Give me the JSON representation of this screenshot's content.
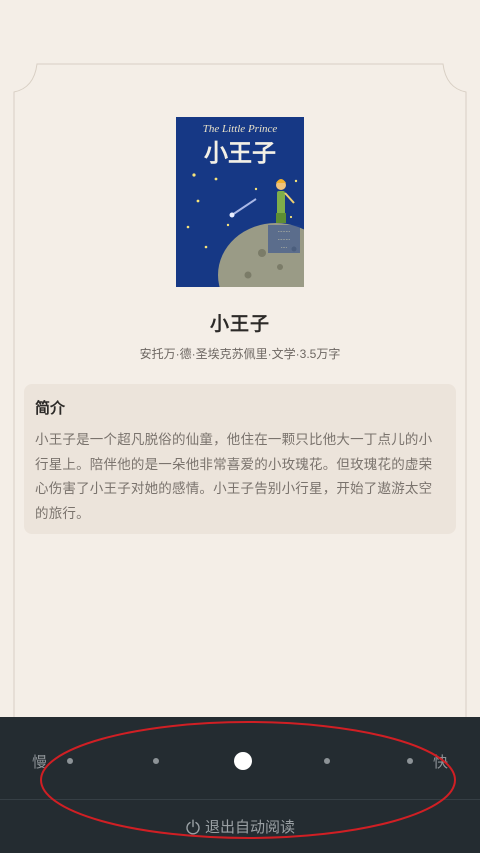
{
  "book": {
    "title": "小王子",
    "meta": "安托万·德·圣埃克苏佩里·文学·3.5万字",
    "cover": {
      "english_title": "The Little Prince",
      "chinese_title": "小王子",
      "colors": {
        "background": "#1b3f91",
        "planet": "#9a9b86",
        "title": "#f3f0e6"
      }
    }
  },
  "intro": {
    "heading": "简介",
    "lines": [
      "小王子是一个超凡脱俗的仙童，他住在一颗只比他大一丁点儿的小",
      "行星上。陪伴他的是一朵他非常喜爱的小玫瑰花。但玫瑰花的虚荣",
      "心伤害了小王子对她的感情。小王子告别小行星，开始了遨游太空",
      "的旅行。"
    ]
  },
  "speed": {
    "slow_label": "慢",
    "fast_label": "快",
    "levels": 5,
    "selected_level": 3
  },
  "exit": {
    "label": "退出自动阅读",
    "icon": "power-icon"
  },
  "colors": {
    "page_background": "#f4eee7",
    "card_background": "#ece4db",
    "panel_background": "#242c31",
    "annotation": "#d01f24"
  }
}
